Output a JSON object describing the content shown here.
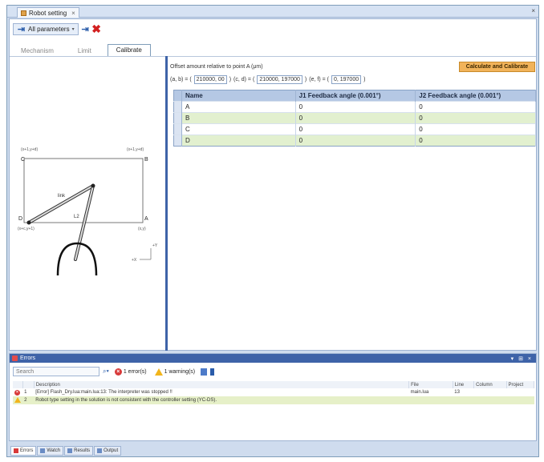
{
  "window": {
    "tab_title": "Robot setting",
    "tab_close": "×",
    "pane_close": "×"
  },
  "toolbar": {
    "all_params_label": "All parameters",
    "add_icon": "add-param-icon",
    "delete_icon": "delete-icon"
  },
  "subtabs": [
    "Mechanism",
    "Limit",
    "Calibrate"
  ],
  "diagram": {
    "label_c": "C",
    "label_b": "B",
    "label_d": "D",
    "label_a": "A",
    "top_left_coord": "(x+1,y+d)",
    "top_right_coord": "(x+1,y+d)",
    "bottom_left_coord": "(x+c,y+1)",
    "bottom_right_coord": "(x,y)",
    "arm1_label": "link",
    "arm2_label": "L2",
    "axis_y": "+Y",
    "axis_x": "+X"
  },
  "calibrate": {
    "offset_label": "Offset amount relative to point A (μm)",
    "calc_button": "Calculate and Calibrate",
    "ab_prefix": "(a, b) = (",
    "ab_value": "210000, 00",
    "cd_prefix": "(c, d) = (",
    "cd_value": "210000, 197000",
    "ef_prefix": "(e, f) = (",
    "ef_value": "0, 197000",
    "columns": [
      "Name",
      "J1 Feedback angle (0.001°)",
      "J2 Feedback angle (0.001°)"
    ],
    "rows": [
      {
        "name": "A",
        "j1": "0",
        "j2": "0"
      },
      {
        "name": "B",
        "j1": "0",
        "j2": "0"
      },
      {
        "name": "C",
        "j1": "0",
        "j2": "0"
      },
      {
        "name": "D",
        "j1": "0",
        "j2": "0"
      }
    ]
  },
  "errors": {
    "title": "Errors",
    "window_controls": "▾ ⊞ ×",
    "search_placeholder": "Search",
    "error_count": "1 error(s)",
    "warning_count": "1 warning(s)",
    "columns": [
      "",
      "",
      "Description",
      "File",
      "Line",
      "Column",
      "Project"
    ],
    "rows": [
      {
        "index": "1",
        "description": "[Error] Flash_Dry.lua:main.lua:13: The interpreter was stopped !!",
        "file": "main.lua",
        "line": "13",
        "column": "",
        "project": ""
      },
      {
        "index": "2",
        "description": "Robot type setting in the solution is not consistent with the controller setting (YC-DS).",
        "file": "",
        "line": "",
        "column": "",
        "project": ""
      }
    ]
  },
  "bottom_tabs": [
    "Errors",
    "Watch",
    "Results",
    "Output"
  ],
  "colors": {
    "accent_blue": "#3e63a8",
    "grid_header": "#b5c8e4",
    "alt_row": "#e2f0cf",
    "calc_button": "#f1b35a",
    "error_red": "#d83a3a",
    "warning_yellow": "#f2b51c"
  }
}
